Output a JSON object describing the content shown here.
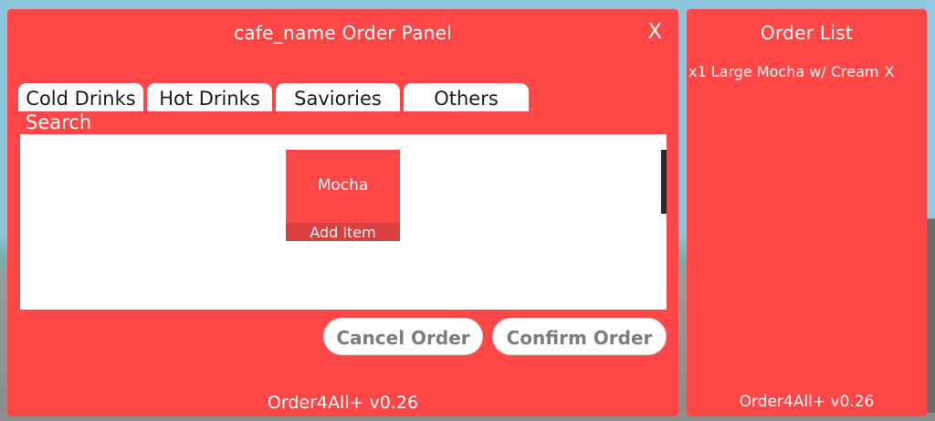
{
  "order_panel": {
    "title": "cafe_name Order Panel",
    "close_label": "X",
    "tabs": [
      {
        "label": "Cold Drinks"
      },
      {
        "label": "Hot Drinks"
      },
      {
        "label": "Saviories"
      },
      {
        "label": "Others"
      }
    ],
    "search_label": "Search",
    "items": [
      {
        "name": "Mocha",
        "add_label": "Add Item"
      }
    ],
    "cancel_label": "Cancel Order",
    "confirm_label": "Confirm Order",
    "version": "Order4All+ v0.26"
  },
  "order_list": {
    "title": "Order List",
    "entries": [
      {
        "text": "x1 Large Mocha w/ Cream",
        "remove_label": "X"
      }
    ],
    "version": "Order4All+ v0.26"
  },
  "colors": {
    "panel_red": "#ff4747",
    "add_bar_red": "#d94040",
    "button_text_gray": "#7c7c7c"
  }
}
